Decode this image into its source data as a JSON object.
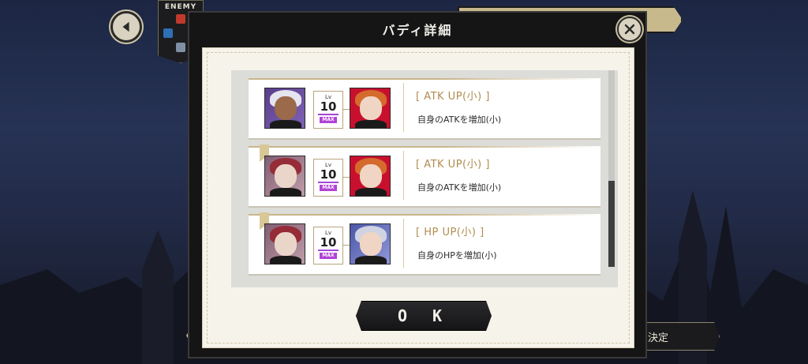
{
  "enemy": {
    "label": "ENEMY"
  },
  "modal": {
    "title": "バディ詳細",
    "ok_label": "O K"
  },
  "buddies": [
    {
      "level_label": "Lv",
      "level": "10",
      "max_label": "MAX",
      "skill_name": "[ ATK UP(小) ]",
      "skill_desc": "自身のATKを増加(小)"
    },
    {
      "level_label": "Lv",
      "level": "10",
      "max_label": "MAX",
      "skill_name": "[ ATK UP(小) ]",
      "skill_desc": "自身のATKを増加(小)"
    },
    {
      "level_label": "Lv",
      "level": "10",
      "max_label": "MAX",
      "skill_name": "[ HP UP(小) ]",
      "skill_desc": "自身のHPを増加(小)"
    }
  ],
  "footer": {
    "decide_label": "決定"
  },
  "colors": {
    "accent_gold": "#b08c4e",
    "max_purple": "#b243d6",
    "modal_dark": "#151515"
  }
}
